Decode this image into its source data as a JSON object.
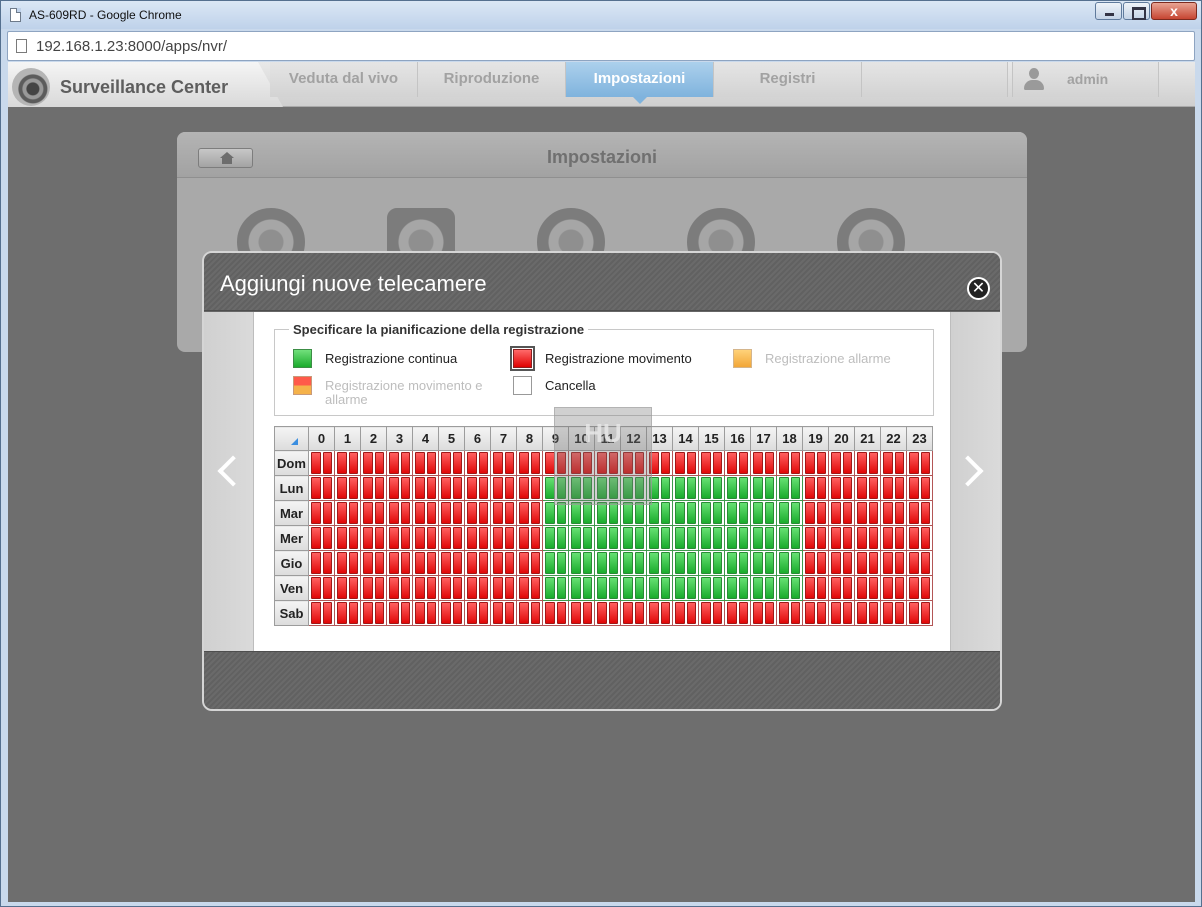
{
  "browser": {
    "window_title": "AS-609RD - Google Chrome",
    "url": "192.168.1.23:8000/apps/nvr/",
    "close_glyph": "x"
  },
  "app": {
    "brand": "Surveillance Center",
    "nav": [
      "Veduta dal vivo",
      "Riproduzione",
      "Impostazioni",
      "Registri"
    ],
    "active_nav": "Impostazioni",
    "user": "admin"
  },
  "settings": {
    "title": "Impostazioni",
    "icons": [
      "speedometer-icon",
      "camera-icon",
      "user-badge-icon",
      "bird-icon",
      "gear-refresh-icon"
    ]
  },
  "modal": {
    "title": "Aggiungi nuove telecamere",
    "close_glyph": "✕",
    "legend_title": "Specificare la pianificazione della registrazione",
    "legend": {
      "continuous": "Registrazione continua",
      "motion": "Registrazione movimento",
      "alarm": "Registrazione allarme",
      "motion_alarm": "Registrazione movimento e allarme",
      "clear": "Cancella"
    },
    "watermark": "HU"
  },
  "schedule": {
    "hours": [
      "0",
      "1",
      "2",
      "3",
      "4",
      "5",
      "6",
      "7",
      "8",
      "9",
      "10",
      "11",
      "12",
      "13",
      "14",
      "15",
      "16",
      "17",
      "18",
      "19",
      "20",
      "21",
      "22",
      "23"
    ],
    "rows": [
      {
        "day": "Dom",
        "cells": "rrrrrrrrrrrrrrrrrrrrrrrr"
      },
      {
        "day": "Lun",
        "cells": "rrrrrrrrrggggggggggrrrrr"
      },
      {
        "day": "Mar",
        "cells": "rrrrrrrrrggggggggggrrrrr"
      },
      {
        "day": "Mer",
        "cells": "rrrrrrrrrggggggggggrrrrr"
      },
      {
        "day": "Gio",
        "cells": "rrrrrrrrrggggggggggrrrrr"
      },
      {
        "day": "Ven",
        "cells": "rrrrrrrrrggggggggggrrrrr"
      },
      {
        "day": "Sab",
        "cells": "rrrrrrrrrrrrrrrrrrrrrrrr"
      }
    ],
    "colors": {
      "motion": "#e10808",
      "continuous": "#1aac2d"
    }
  }
}
